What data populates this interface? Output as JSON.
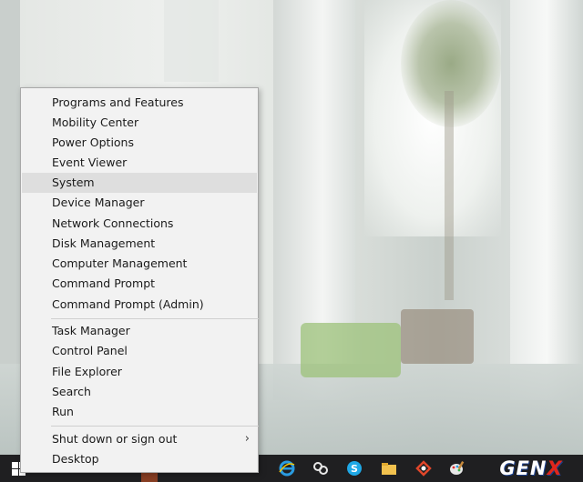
{
  "context_menu": {
    "group1": [
      {
        "label": "Programs and Features"
      },
      {
        "label": "Mobility Center"
      },
      {
        "label": "Power Options"
      },
      {
        "label": "Event Viewer"
      },
      {
        "label": "System",
        "highlighted": true
      },
      {
        "label": "Device Manager"
      },
      {
        "label": "Network Connections"
      },
      {
        "label": "Disk Management"
      },
      {
        "label": "Computer Management"
      },
      {
        "label": "Command Prompt"
      },
      {
        "label": "Command Prompt (Admin)"
      }
    ],
    "group2": [
      {
        "label": "Task Manager"
      },
      {
        "label": "Control Panel"
      },
      {
        "label": "File Explorer"
      },
      {
        "label": "Search"
      },
      {
        "label": "Run"
      }
    ],
    "group3": [
      {
        "label": "Shut down or sign out",
        "submenu_arrow": "›"
      },
      {
        "label": "Desktop"
      }
    ]
  },
  "taskbar": {
    "icons": [
      "start-windows-icon",
      "edge-ie-icon",
      "network-icon",
      "skype-icon",
      "folder-icon",
      "app-icon",
      "paint-icon"
    ]
  },
  "watermark": {
    "text_main": "GEN",
    "text_x": "X"
  },
  "colors": {
    "menu_bg": "#f2f2f2",
    "highlight": "#dedede",
    "taskbar": "#1f1f21"
  }
}
